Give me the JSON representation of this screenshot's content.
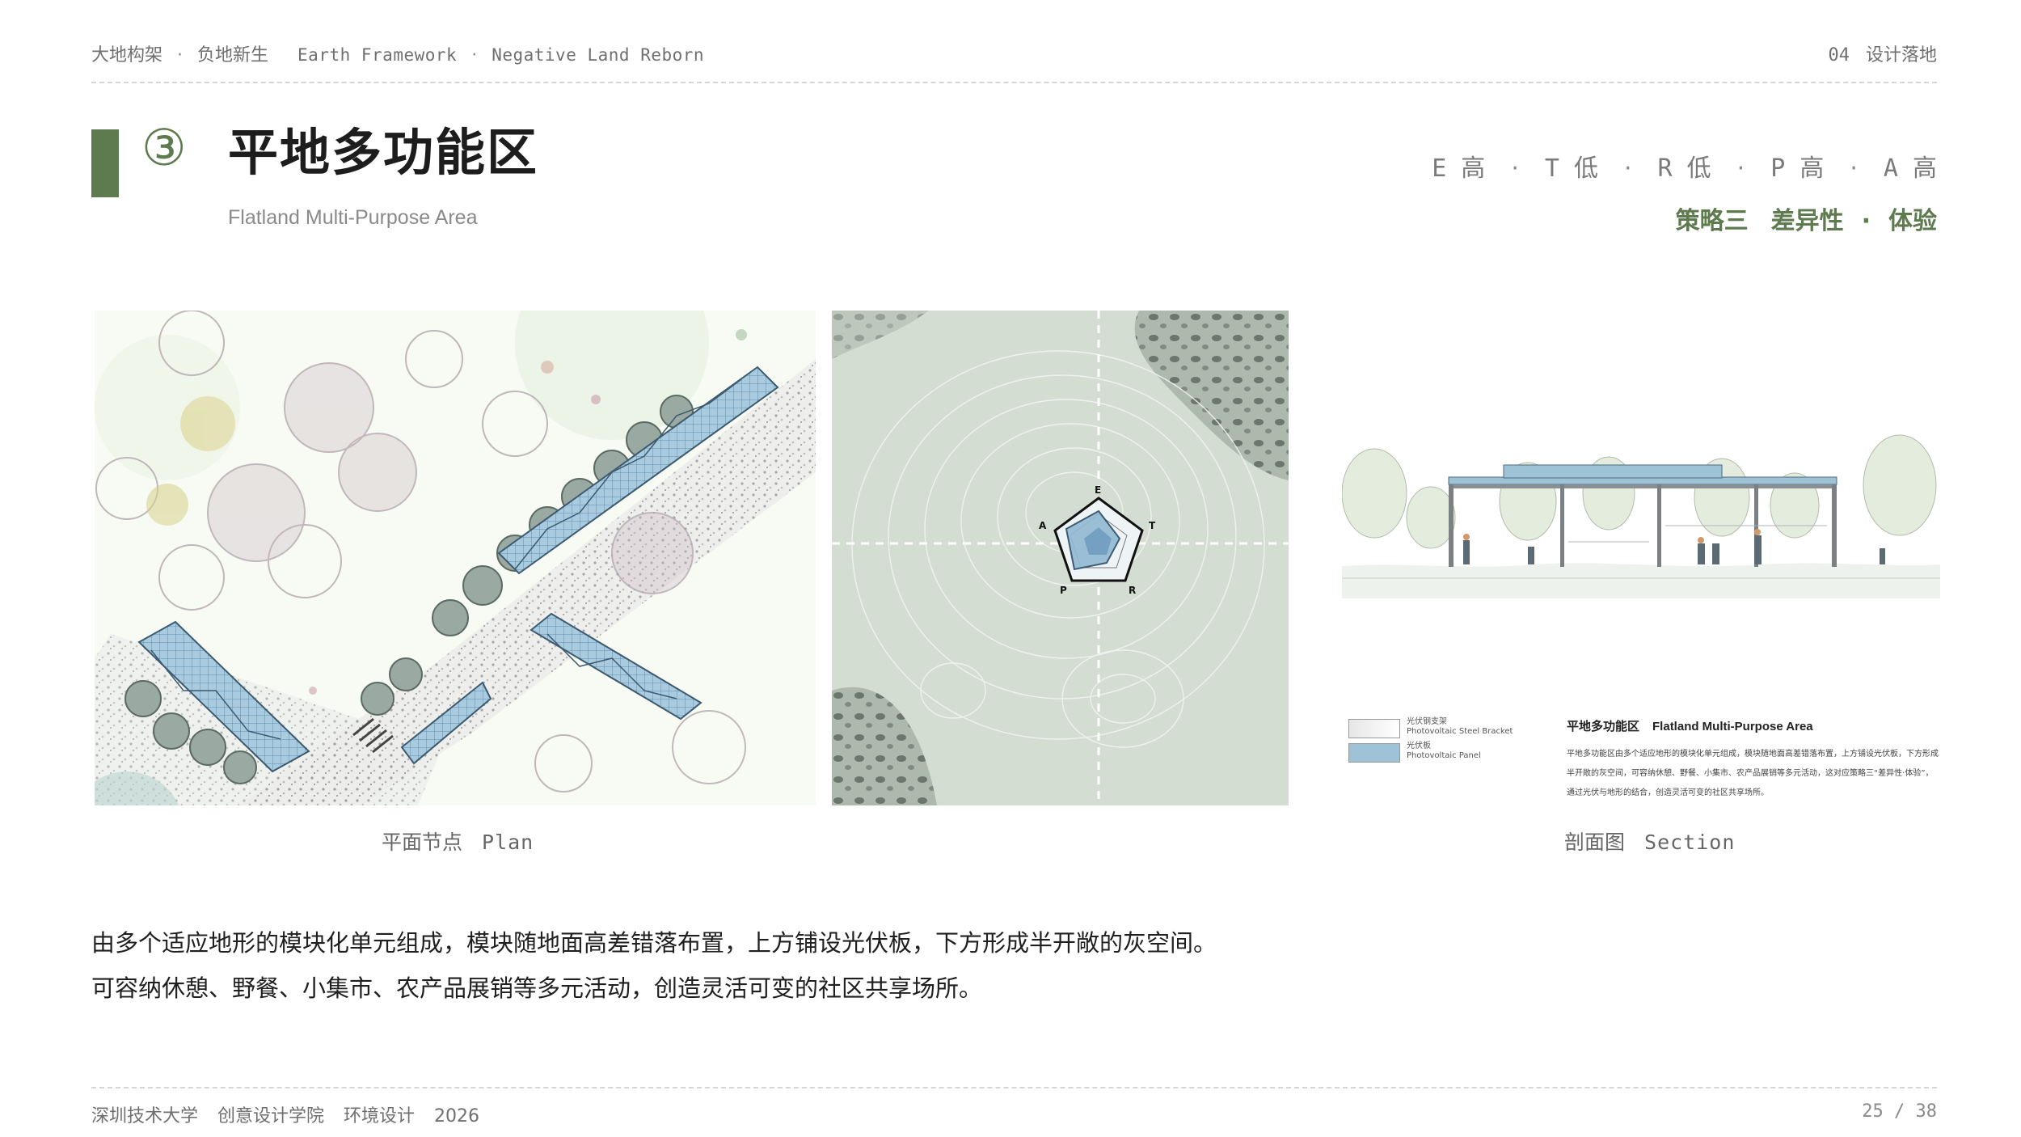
{
  "header": {
    "project_cn_1": "大地构架",
    "project_cn_2": "负地新生",
    "project_en_1": "Earth Framework",
    "project_en_2": "Negative Land Reborn",
    "separator": "·",
    "chapter_num": "04",
    "chapter_title": "设计落地"
  },
  "title": {
    "number": "③",
    "main": "平地多功能区",
    "sub": "Flatland Multi-Purpose Area"
  },
  "metrics": [
    {
      "label": "E 高"
    },
    {
      "label": "T 低"
    },
    {
      "label": "R 低"
    },
    {
      "label": "P 高"
    },
    {
      "label": "A 高"
    }
  ],
  "strategy": {
    "label": "策略三",
    "name": "差异性",
    "separator": "·",
    "focus": "体验"
  },
  "radar": {
    "axes": [
      "E",
      "T",
      "R",
      "P",
      "A"
    ]
  },
  "captions": {
    "plan_cn": "平面节点",
    "plan_en": "Plan",
    "section_cn": "剖面图",
    "section_en": "Section"
  },
  "section_legend": {
    "item1_cn": "光伏钢支架",
    "item1_en": "Photovoltaic Steel Bracket",
    "item2_cn": "光伏板",
    "item2_en": "Photovoltaic Panel",
    "title_cn": "平地多功能区",
    "title_en": "Flatland Multi-Purpose Area",
    "body": "平地多功能区由多个适应地形的模块化单元组成，模块随地面高差错落布置，上方铺设光伏板，下方形成半开敞的灰空间，可容纳休憩、野餐、小集市、农产品展销等多元活动，这对应策略三“差异性·体验”，通过光伏与地形的结合，创造灵活可变的社区共享场所。"
  },
  "body_text": {
    "line1": "由多个适应地形的模块化单元组成，模块随地面高差错落布置，上方铺设光伏板，下方形成半开敞的灰空间。",
    "line2": "可容纳休憩、野餐、小集市、农产品展销等多元活动，创造灵活可变的社区共享场所。"
  },
  "footer": {
    "school": "深圳技术大学",
    "college": "创意设计学院",
    "major": "环境设计",
    "year": "2026",
    "page": "25 / 38"
  },
  "colors": {
    "accent": "#5e7a4f",
    "panel_blue": "#9fc3d6"
  }
}
